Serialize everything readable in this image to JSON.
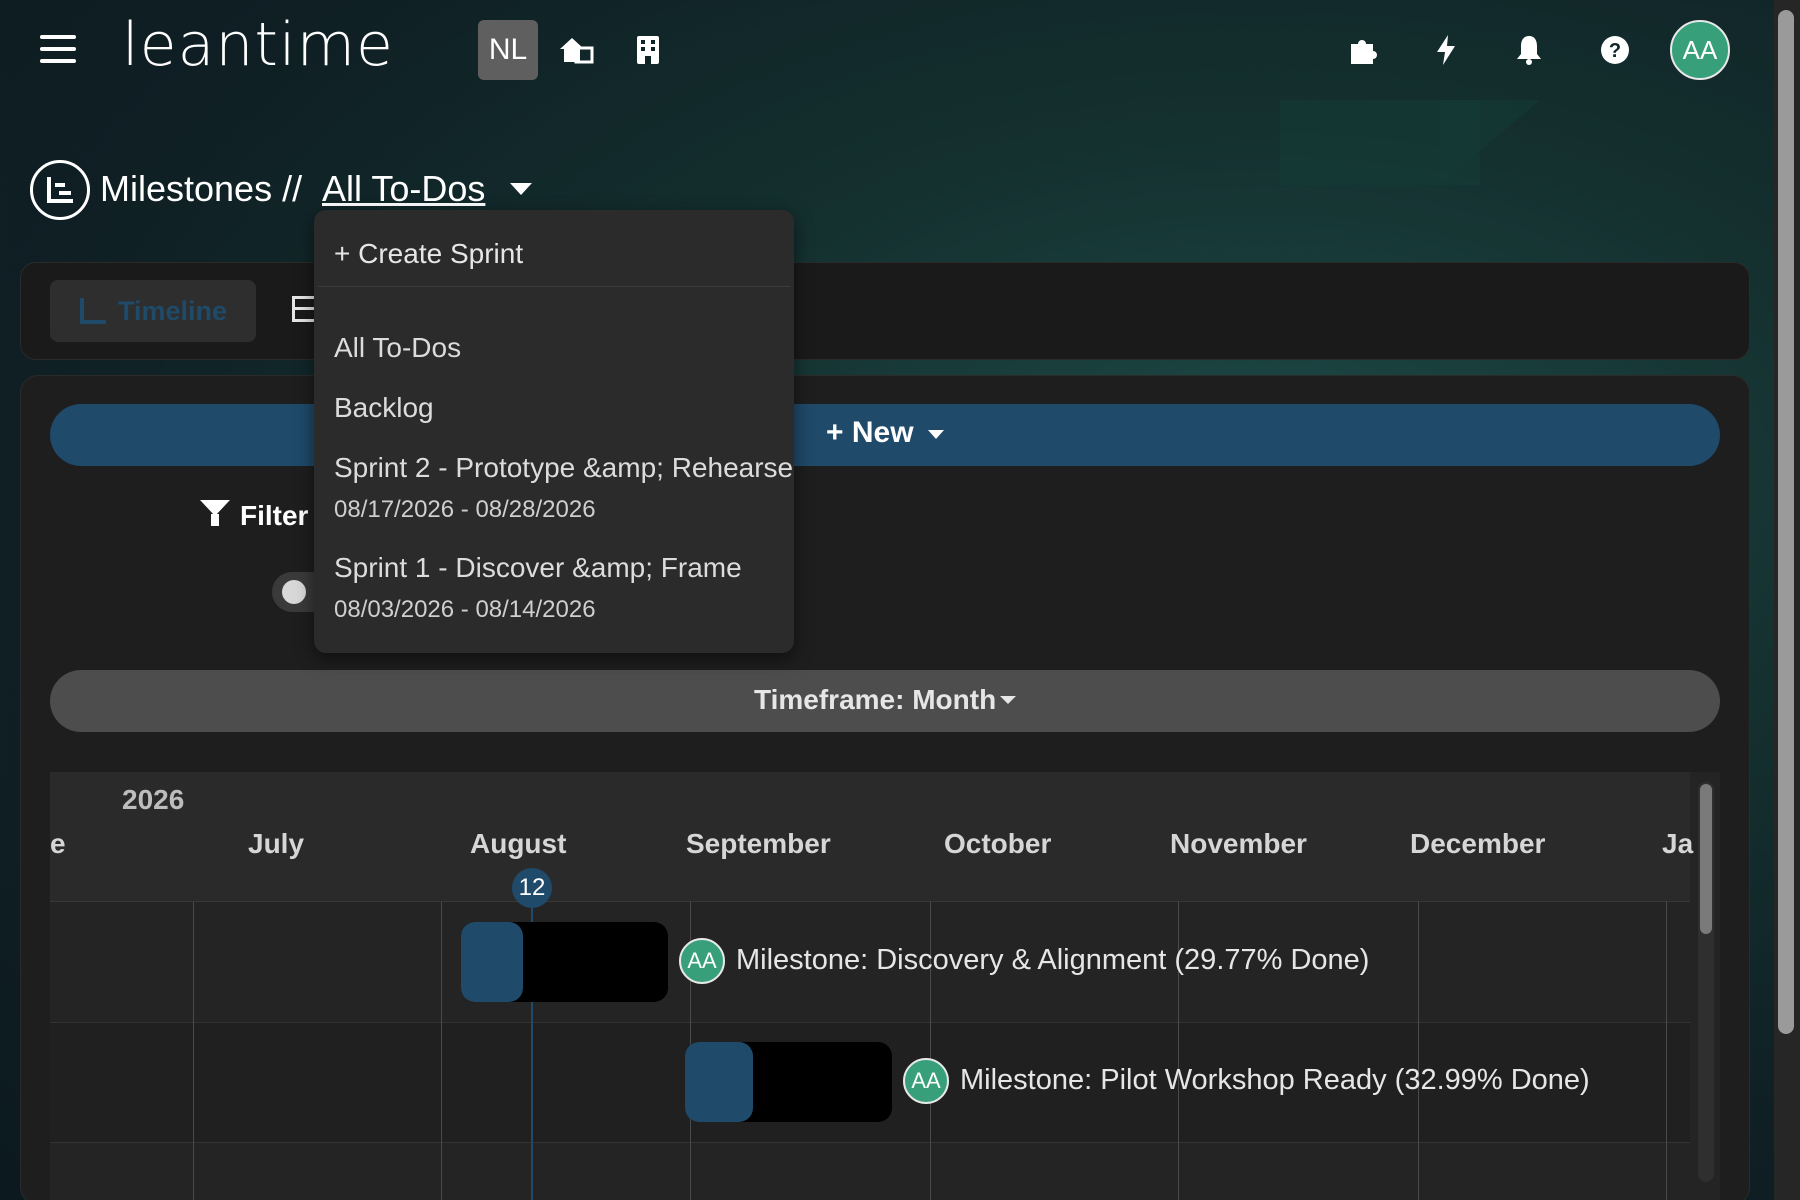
{
  "header": {
    "logo_text": "leantime",
    "project_badge": "NL",
    "avatar_initials": "AA",
    "icons": [
      "menu-icon",
      "home-switch-icon",
      "building-icon",
      "puzzle-icon",
      "bolt-icon",
      "bell-icon",
      "help-icon"
    ]
  },
  "breadcrumb": {
    "section": "Milestones //",
    "current": "All To-Dos"
  },
  "tabs": {
    "active": "Timeline"
  },
  "toolbar": {
    "new_label": "New",
    "filter_label": "Filter",
    "timeframe_label": "Timeframe:  Month"
  },
  "dropdown": {
    "create": "Create Sprint",
    "items": [
      {
        "label": "All To-Dos"
      },
      {
        "label": "Backlog"
      },
      {
        "label": "Sprint 2 - Prototype &amp; Rehearse",
        "dates": "08/17/2026 - 08/28/2026"
      },
      {
        "label": "Sprint 1 - Discover &amp; Frame",
        "dates": "08/03/2026 - 08/14/2026"
      }
    ]
  },
  "gantt": {
    "year": "2026",
    "months": [
      "e",
      "July",
      "August",
      "September",
      "October",
      "November",
      "December",
      "Ja"
    ],
    "today": "12",
    "rows": [
      {
        "avatar": "AA",
        "label": "Milestone: Discovery & Alignment (29.77% Done)",
        "progress": 0.2977
      },
      {
        "avatar": "AA",
        "label": "Milestone: Pilot Workshop Ready (32.99% Done)",
        "progress": 0.3299
      }
    ]
  },
  "colors": {
    "accent": "#1f4a6a",
    "avatar": "#37a07a",
    "panel": "#1e1e1e"
  }
}
